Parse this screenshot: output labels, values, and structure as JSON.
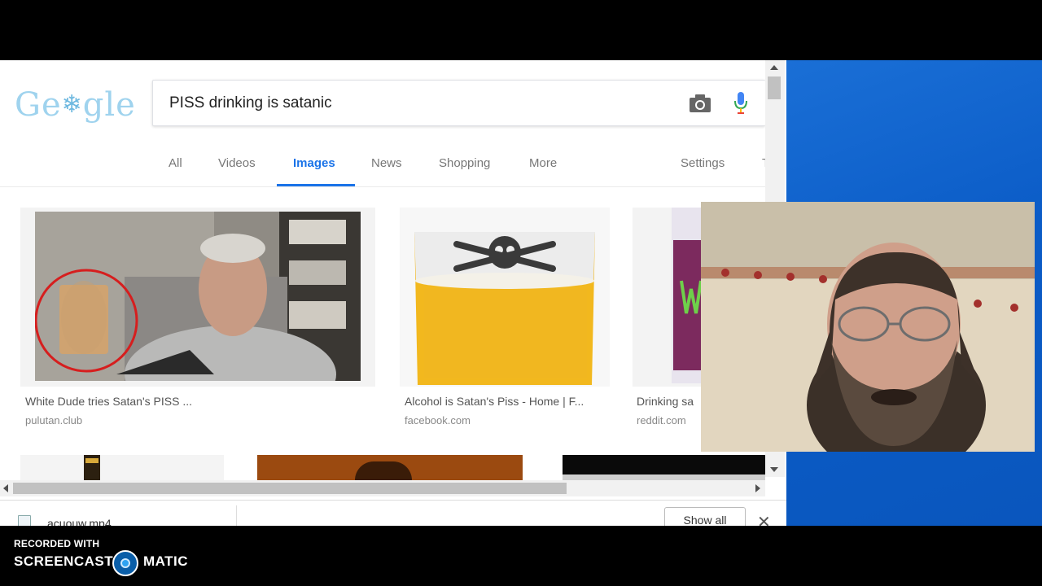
{
  "search": {
    "logo_text": "Ge",
    "logo_text_end": "gle",
    "query": "PISS drinking is satanic"
  },
  "tabs": {
    "all": "All",
    "videos": "Videos",
    "images": "Images",
    "news": "News",
    "shopping": "Shopping",
    "more": "More",
    "settings": "Settings"
  },
  "results": [
    {
      "caption": "White Dude tries Satan's PISS ...",
      "domain": "pulutan.club"
    },
    {
      "caption": "Alcohol is Satan's Piss - Home | F...",
      "domain": "facebook.com"
    },
    {
      "caption": "Drinking sa",
      "domain": "reddit.com"
    }
  ],
  "downloads": {
    "filename": "acuouw.mp4",
    "show_all": "Show all",
    "close": "✕"
  },
  "watermark": {
    "recorded_with": "RECORDED WITH",
    "brand_left": "SCREENCAST",
    "brand_right": "MATIC"
  },
  "colors": {
    "accent": "#1a73e8",
    "desktop": "#0b5cc7"
  }
}
